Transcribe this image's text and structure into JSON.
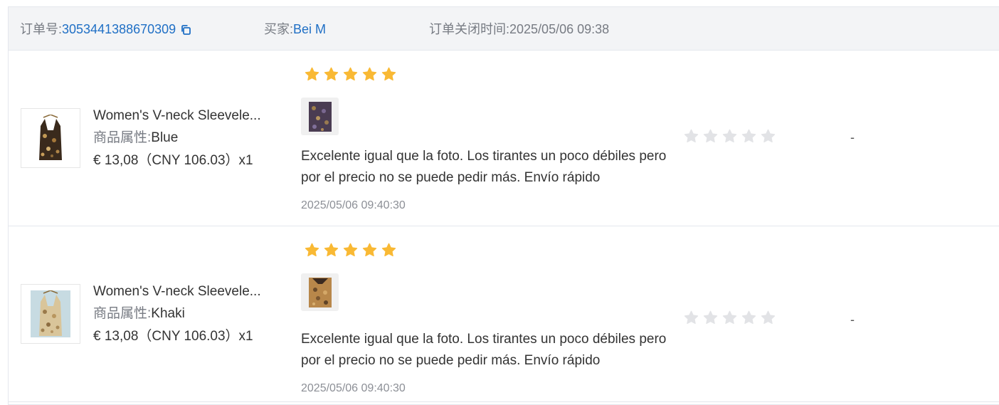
{
  "order": {
    "number_label": "订单号:",
    "number": "3053441388670309",
    "buyer_label": "买家:",
    "buyer": "Bei M",
    "closed_label": "订单关闭时间:",
    "closed_time": "2025/05/06 09:38"
  },
  "colors": {
    "star_filled": "#f9b934",
    "star_empty": "#e2e3e6",
    "link": "#1f6fc5"
  },
  "items": [
    {
      "title": "Women's V-neck Sleevele...",
      "attr_label": "商品属性:",
      "attr_value": "Blue",
      "price": "€ 13,08（CNY  106.03）x1",
      "review_rating": 5,
      "review_text": "Excelente igual que la foto. Los tirantes un poco débiles pero por el precio no se puede pedir más. Envío rápido",
      "review_time": "2025/05/06 09:40:30",
      "seller_rating": 0,
      "reply": "-"
    },
    {
      "title": "Women's V-neck Sleevele...",
      "attr_label": "商品属性:",
      "attr_value": "Khaki",
      "price": "€ 13,08（CNY  106.03）x1",
      "review_rating": 5,
      "review_text": "Excelente igual que la foto. Los tirantes un poco débiles pero por el precio no se puede pedir más. Envío rápido",
      "review_time": "2025/05/06 09:40:30",
      "seller_rating": 0,
      "reply": "-"
    }
  ]
}
